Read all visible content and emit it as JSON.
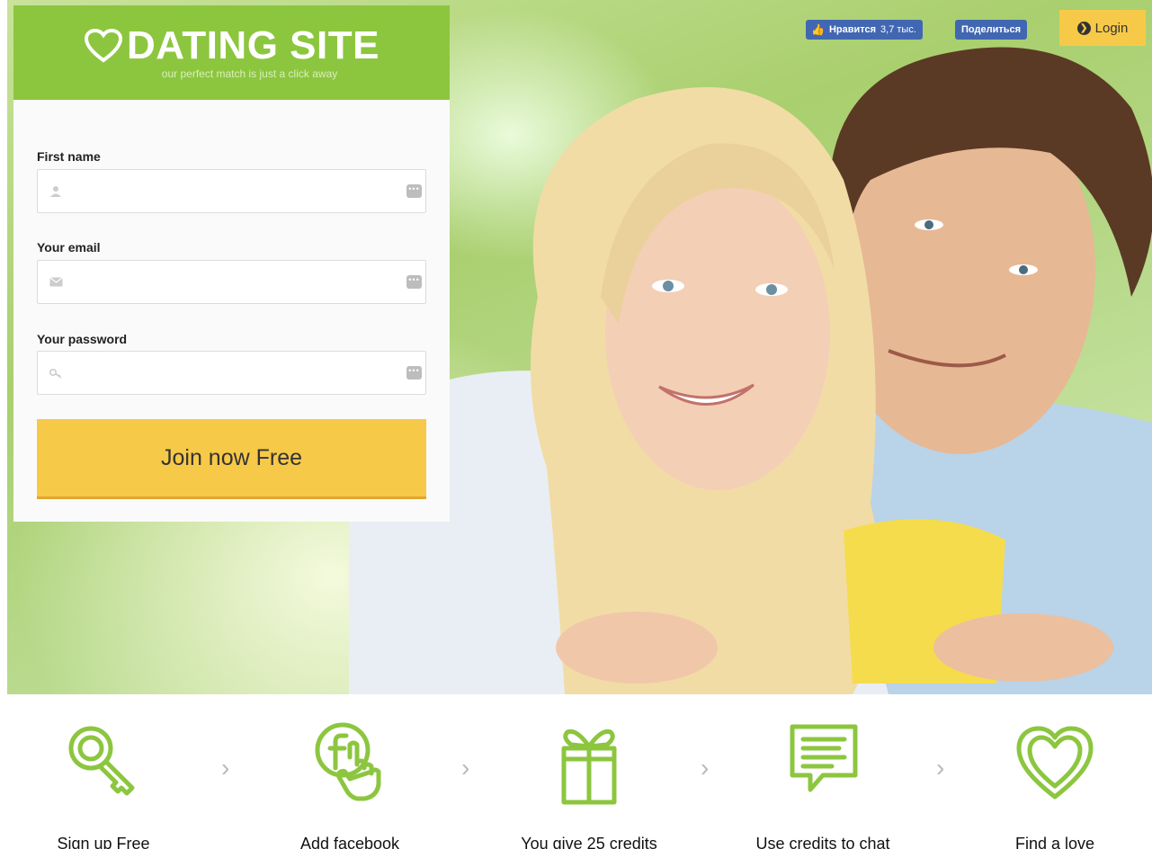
{
  "site": {
    "logo_text": "DATING SITE",
    "tagline": "our perfect match is just a click away"
  },
  "social": {
    "like_label": "Нравится",
    "like_count": "3,7 тыс.",
    "share_label": "Поделиться"
  },
  "login": {
    "label": "Login"
  },
  "form": {
    "first_name_label": "First name",
    "email_label": "Your email",
    "password_label": "Your password",
    "first_name_value": "",
    "email_value": "",
    "password_value": "",
    "submit_label": "Join now Free"
  },
  "steps": [
    {
      "label": "Sign up Free",
      "icon": "key-icon"
    },
    {
      "label": "Add facebook",
      "icon": "facebook-hand-icon"
    },
    {
      "label": "You give 25 credits",
      "icon": "gift-icon"
    },
    {
      "label": "Use credits to chat",
      "icon": "chat-icon"
    },
    {
      "label": "Find a love",
      "icon": "heart-icon"
    }
  ],
  "colors": {
    "brand_green": "#8cc63f",
    "button_yellow": "#f7c948",
    "facebook_blue": "#4267b2"
  }
}
